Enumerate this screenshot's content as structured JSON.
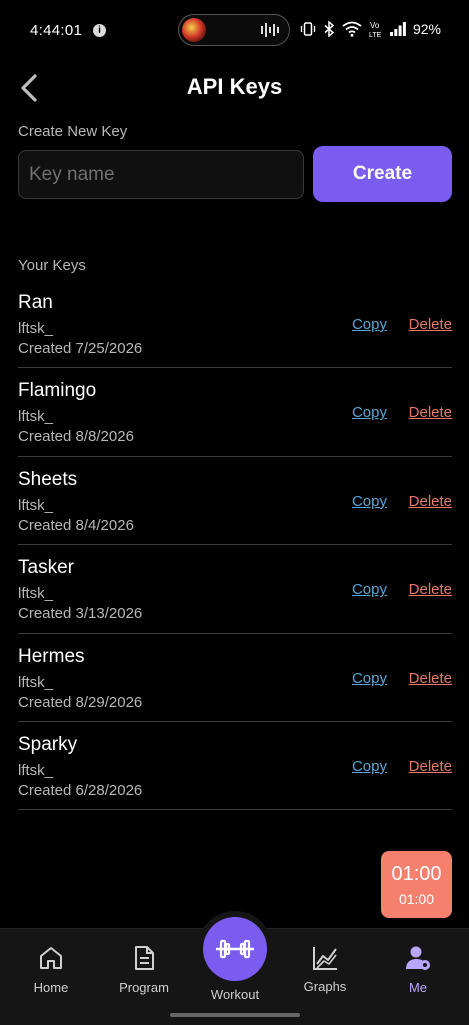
{
  "status_bar": {
    "time": "4:44:01",
    "info_icon": "i",
    "battery": "92%"
  },
  "header": {
    "title": "API Keys"
  },
  "create": {
    "section_label": "Create New Key",
    "input_placeholder": "Key name",
    "input_value": "",
    "button_label": "Create"
  },
  "keys": {
    "section_label": "Your Keys",
    "copy_label": "Copy",
    "delete_label": "Delete",
    "items": [
      {
        "name": "Ran",
        "prefix": "lftsk_",
        "created": "Created 7/25/2026"
      },
      {
        "name": "Flamingo",
        "prefix": "lftsk_",
        "created": "Created 8/8/2026"
      },
      {
        "name": "Sheets",
        "prefix": "lftsk_",
        "created": "Created 8/4/2026"
      },
      {
        "name": "Tasker",
        "prefix": "lftsk_",
        "created": "Created 3/13/2026"
      },
      {
        "name": "Hermes",
        "prefix": "lftsk_",
        "created": "Created 8/29/2026"
      },
      {
        "name": "Sparky",
        "prefix": "lftsk_",
        "created": "Created 6/28/2026"
      }
    ]
  },
  "timer": {
    "main": "01:00",
    "sub": "01:00",
    "color": "#f5806d"
  },
  "nav": {
    "home": "Home",
    "program": "Program",
    "workout": "Workout",
    "graphs": "Graphs",
    "me": "Me",
    "accent": "#7b5cf0"
  }
}
